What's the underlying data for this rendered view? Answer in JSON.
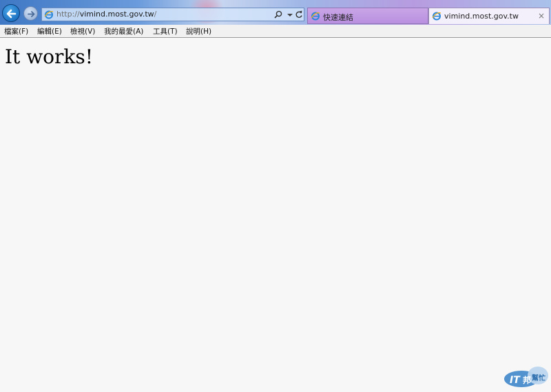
{
  "browser": {
    "address": {
      "scheme": "http://",
      "domain": "vimind.most.gov.tw",
      "path": "/"
    },
    "tabs": [
      {
        "label": "快速連結",
        "active": false
      },
      {
        "label": "vimind.most.gov.tw",
        "active": true,
        "close": "×"
      }
    ]
  },
  "menu": {
    "items": [
      "檔案(F)",
      "編輯(E)",
      "檢視(V)",
      "我的最愛(A)",
      "工具(T)",
      "說明(H)"
    ]
  },
  "page": {
    "heading": "It works!"
  },
  "watermark": {
    "text_main": "IT",
    "text_side": "邦",
    "text_sub": "幫忙"
  },
  "colors": {
    "back_button": "#0d5fb4",
    "active_tab": "#f4f0fb",
    "quick_tab": "#b98fe0",
    "page_background": "#f7f7f7"
  },
  "icons": [
    "back-arrow-icon",
    "forward-arrow-icon",
    "ie-icon",
    "search-icon",
    "dropdown-arrow-icon",
    "refresh-icon",
    "close-icon"
  ]
}
